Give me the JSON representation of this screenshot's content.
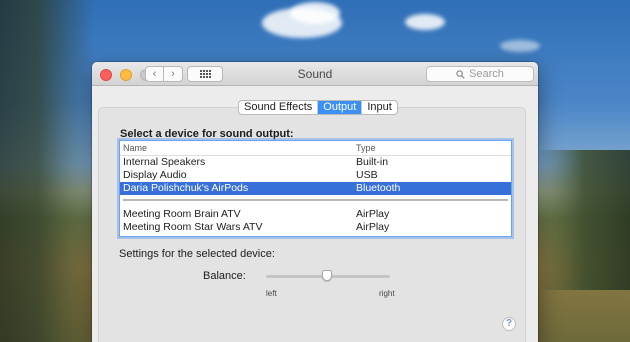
{
  "window": {
    "title": "Sound",
    "search_placeholder": "Search"
  },
  "tabs": [
    {
      "label": "Sound Effects",
      "active": false
    },
    {
      "label": "Output",
      "active": true
    },
    {
      "label": "Input",
      "active": false
    }
  ],
  "output": {
    "heading": "Select a device for sound output:",
    "columns": {
      "name": "Name",
      "type": "Type"
    },
    "devices": [
      {
        "name": "Internal Speakers",
        "type": "Built-in",
        "selected": false
      },
      {
        "name": "Display Audio",
        "type": "USB",
        "selected": false
      },
      {
        "name": "Daria Polishchuk's AirPods",
        "type": "Bluetooth",
        "selected": true
      },
      {
        "name": "Meeting Room Brain ATV",
        "type": "AirPlay",
        "selected": false
      },
      {
        "name": "Meeting Room Star Wars ATV",
        "type": "AirPlay",
        "selected": false
      }
    ],
    "settings_label": "Settings for the selected device:",
    "balance": {
      "label": "Balance:",
      "left_label": "left",
      "right_label": "right",
      "value": 0.5
    },
    "help_label": "?"
  },
  "colors": {
    "selection": "#3670d8",
    "active_tab": "#3b8ff5"
  }
}
